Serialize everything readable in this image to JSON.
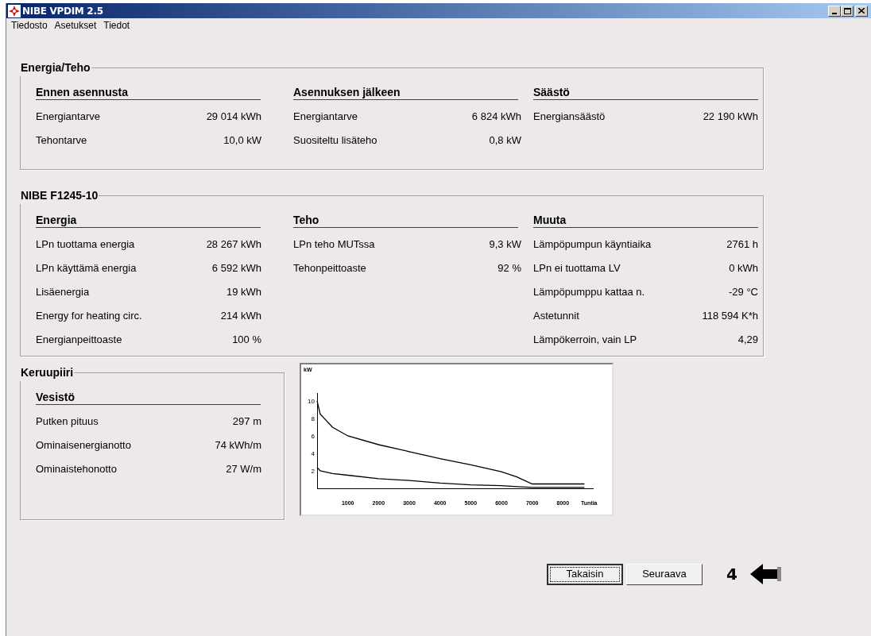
{
  "window": {
    "title": "NIBE VPDIM 2.5"
  },
  "menu": [
    "Tiedosto",
    "Asetukset",
    "Tiedot"
  ],
  "groups": [
    {
      "title": "Energia/Teho",
      "columns": [
        {
          "heading": "Ennen asennusta",
          "rows": [
            {
              "label": "Energiantarve",
              "value": "29 014 kWh"
            },
            {
              "label": "Tehontarve",
              "value": "10,0 kW"
            }
          ]
        },
        {
          "heading": "Asennuksen jälkeen",
          "rows": [
            {
              "label": "Energiantarve",
              "value": "6 824 kWh"
            },
            {
              "label": "Suositeltu lisäteho",
              "value": "0,8 kW"
            }
          ]
        },
        {
          "heading": "Säästö",
          "rows": [
            {
              "label": "Energiansäästö",
              "value": "22 190 kWh"
            }
          ]
        }
      ]
    },
    {
      "title": "NIBE F1245-10",
      "columns": [
        {
          "heading": "Energia",
          "rows": [
            {
              "label": "LPn tuottama energia",
              "value": "28 267 kWh"
            },
            {
              "label": "LPn käyttämä energia",
              "value": "6 592 kWh"
            },
            {
              "label": "Lisäenergia",
              "value": "19 kWh"
            },
            {
              "label": "Energy for heating circ.",
              "value": "214 kWh"
            },
            {
              "label": "Energianpeittoaste",
              "value": "100 %"
            }
          ]
        },
        {
          "heading": "Teho",
          "rows": [
            {
              "label": "LPn teho MUTssa",
              "value": "9,3 kW"
            },
            {
              "label": "Tehonpeittoaste",
              "value": "92 %"
            }
          ]
        },
        {
          "heading": "Muuta",
          "rows": [
            {
              "label": "Lämpöpumpun käyntiaika",
              "value": "2761 h"
            },
            {
              "label": "LPn ei tuottama LV",
              "value": "0 kWh"
            },
            {
              "label": "Lämpöpumppu kattaa n.",
              "value": "-29 °C"
            },
            {
              "label": "Astetunnit",
              "value": "118 594 K*h"
            },
            {
              "label": "Lämpökerroin, vain LP",
              "value": "4,29"
            }
          ]
        }
      ]
    }
  ],
  "collector": {
    "title": "Keruupiiri",
    "columns": [
      {
        "heading": "Vesistö",
        "rows": [
          {
            "label": "Putken pituus",
            "value": "297 m"
          },
          {
            "label": "Ominaisenergianotto",
            "value": "74 kWh/m"
          },
          {
            "label": "Ominaistehonotto",
            "value": "27 W/m"
          }
        ]
      }
    ]
  },
  "chart": {
    "chart_data": {
      "type": "line",
      "ylabel": "kW",
      "xlabel": "Tuntia",
      "x": [
        0,
        100,
        500,
        1000,
        2000,
        3000,
        4000,
        5000,
        6000,
        6500,
        7000,
        8700
      ],
      "series": [
        {
          "color": "#000000",
          "values": [
            10,
            8.5,
            7,
            6,
            5,
            4.2,
            3.4,
            2.7,
            1.9,
            1.3,
            0.5,
            0.5
          ]
        },
        {
          "color": "#000000",
          "values": [
            2.4,
            2,
            1.7,
            1.5,
            1.1,
            0.9,
            0.6,
            0.4,
            0.3,
            0.2,
            0.1,
            0.1
          ]
        }
      ],
      "xticks": [
        1000,
        2000,
        3000,
        4000,
        5000,
        6000,
        7000,
        8000
      ],
      "yticks": [
        2,
        4,
        6,
        8,
        10
      ],
      "xlim": [
        0,
        9000
      ],
      "ylim": [
        0,
        11
      ]
    }
  },
  "buttons": [
    {
      "label": "Takaisin",
      "focused": true
    },
    {
      "label": "Seuraava",
      "focused": false
    }
  ],
  "page_number": "4"
}
